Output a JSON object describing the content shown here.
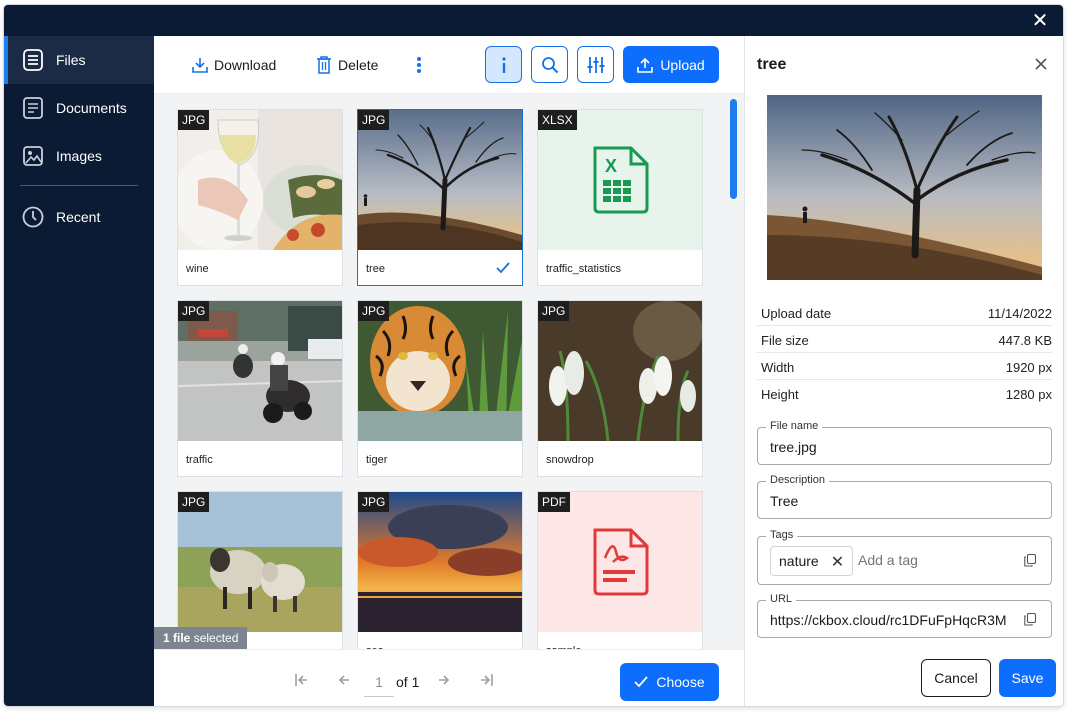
{
  "window": {
    "close_icon": "close-icon"
  },
  "sidebar": {
    "items": [
      {
        "label": "Files",
        "icon": "files-icon",
        "active": true
      },
      {
        "label": "Documents",
        "icon": "document-icon",
        "active": false
      },
      {
        "label": "Images",
        "icon": "image-icon",
        "active": false
      },
      {
        "label": "Recent",
        "icon": "clock-icon",
        "active": false
      }
    ]
  },
  "toolbar": {
    "download_label": "Download",
    "delete_label": "Delete",
    "more_icon": "more-vertical-icon",
    "info_icon": "info-icon",
    "search_icon": "search-icon",
    "settings_icon": "sliders-icon",
    "upload_label": "Upload"
  },
  "files": [
    {
      "name": "wine",
      "type": "JPG",
      "selected": false
    },
    {
      "name": "tree",
      "type": "JPG",
      "selected": true
    },
    {
      "name": "traffic_statistics",
      "type": "XLSX",
      "selected": false
    },
    {
      "name": "traffic",
      "type": "JPG",
      "selected": false
    },
    {
      "name": "tiger",
      "type": "JPG",
      "selected": false
    },
    {
      "name": "snowdrop",
      "type": "JPG",
      "selected": false
    },
    {
      "name": "sheep",
      "type": "JPG",
      "selected": false
    },
    {
      "name": "sea",
      "type": "JPG",
      "selected": false
    },
    {
      "name": "sample",
      "type": "PDF",
      "selected": false
    }
  ],
  "selection": {
    "count_bold": "1 file",
    "rest": " selected"
  },
  "pagination": {
    "page": "1",
    "of": "of 1"
  },
  "footer": {
    "choose_label": "Choose"
  },
  "details": {
    "title": "tree",
    "meta": [
      {
        "key": "Upload date",
        "value": "11/14/2022"
      },
      {
        "key": "File size",
        "value": "447.8 KB"
      },
      {
        "key": "Width",
        "value": "1920 px"
      },
      {
        "key": "Height",
        "value": "1280 px"
      }
    ],
    "file_name_label": "File name",
    "file_name_value": "tree.jpg",
    "description_label": "Description",
    "description_value": "Tree",
    "tags_label": "Tags",
    "tags": [
      "nature"
    ],
    "tag_placeholder": "Add a tag",
    "url_label": "URL",
    "url_value": "https://ckbox.cloud/rc1DFuFpHqcR3M",
    "cancel_label": "Cancel",
    "save_label": "Save"
  },
  "colors": {
    "accent": "#0d6efd",
    "sidebar_bg": "#0b1b33",
    "grid_bg": "#f2f3f5"
  }
}
